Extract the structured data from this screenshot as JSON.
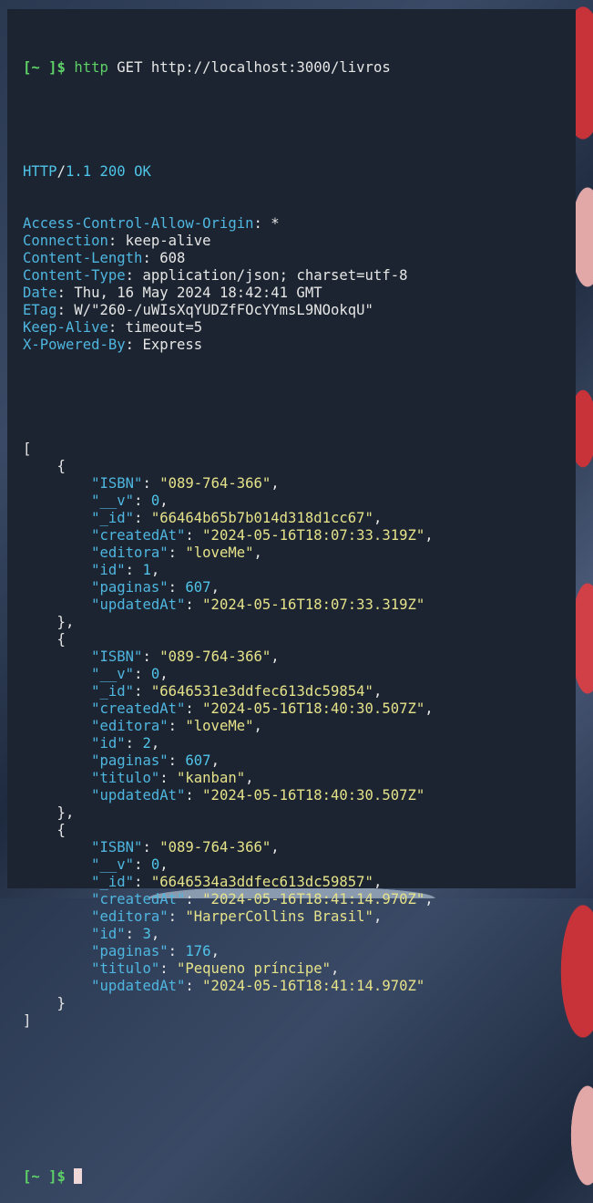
{
  "prompt": "[~ ]$",
  "command": {
    "program": "http",
    "rest": " GET http://localhost:3000/livros"
  },
  "status": {
    "proto": "HTTP",
    "slash": "/",
    "version": "1.1",
    "code": "200",
    "reason": "OK"
  },
  "headers": [
    {
      "name": "Access-Control-Allow-Origin",
      "value": " *"
    },
    {
      "name": "Connection",
      "value": " keep-alive"
    },
    {
      "name": "Content-Length",
      "value": " 608"
    },
    {
      "name": "Content-Type",
      "value": " application/json; charset=utf-8"
    },
    {
      "name": "Date",
      "value": " Thu, 16 May 2024 18:42:41 GMT"
    },
    {
      "name": "ETag",
      "value": " W/\"260-/uWIsXqYUDZfFOcYYmsL9NOokqU\""
    },
    {
      "name": "Keep-Alive",
      "value": " timeout=5"
    },
    {
      "name": "X-Powered-By",
      "value": " Express"
    }
  ],
  "records": [
    [
      {
        "k": "\"ISBN\"",
        "v": "\"089-764-366\"",
        "t": "str"
      },
      {
        "k": "\"__v\"",
        "v": "0",
        "t": "num"
      },
      {
        "k": "\"_id\"",
        "v": "\"66464b65b7b014d318d1cc67\"",
        "t": "str"
      },
      {
        "k": "\"createdAt\"",
        "v": "\"2024-05-16T18:07:33.319Z\"",
        "t": "str"
      },
      {
        "k": "\"editora\"",
        "v": "\"loveMe\"",
        "t": "str"
      },
      {
        "k": "\"id\"",
        "v": "1",
        "t": "num"
      },
      {
        "k": "\"paginas\"",
        "v": "607",
        "t": "num"
      },
      {
        "k": "\"updatedAt\"",
        "v": "\"2024-05-16T18:07:33.319Z\"",
        "t": "str"
      }
    ],
    [
      {
        "k": "\"ISBN\"",
        "v": "\"089-764-366\"",
        "t": "str"
      },
      {
        "k": "\"__v\"",
        "v": "0",
        "t": "num"
      },
      {
        "k": "\"_id\"",
        "v": "\"6646531e3ddfec613dc59854\"",
        "t": "str"
      },
      {
        "k": "\"createdAt\"",
        "v": "\"2024-05-16T18:40:30.507Z\"",
        "t": "str"
      },
      {
        "k": "\"editora\"",
        "v": "\"loveMe\"",
        "t": "str"
      },
      {
        "k": "\"id\"",
        "v": "2",
        "t": "num"
      },
      {
        "k": "\"paginas\"",
        "v": "607",
        "t": "num"
      },
      {
        "k": "\"titulo\"",
        "v": "\"kanban\"",
        "t": "str"
      },
      {
        "k": "\"updatedAt\"",
        "v": "\"2024-05-16T18:40:30.507Z\"",
        "t": "str"
      }
    ],
    [
      {
        "k": "\"ISBN\"",
        "v": "\"089-764-366\"",
        "t": "str"
      },
      {
        "k": "\"__v\"",
        "v": "0",
        "t": "num"
      },
      {
        "k": "\"_id\"",
        "v": "\"6646534a3ddfec613dc59857\"",
        "t": "str"
      },
      {
        "k": "\"createdAt\"",
        "v": "\"2024-05-16T18:41:14.970Z\"",
        "t": "str"
      },
      {
        "k": "\"editora\"",
        "v": "\"HarperCollins Brasil\"",
        "t": "str"
      },
      {
        "k": "\"id\"",
        "v": "3",
        "t": "num"
      },
      {
        "k": "\"paginas\"",
        "v": "176",
        "t": "num"
      },
      {
        "k": "\"titulo\"",
        "v": "\"Pequeno príncipe\"",
        "t": "str"
      },
      {
        "k": "\"updatedAt\"",
        "v": "\"2024-05-16T18:41:14.970Z\"",
        "t": "str"
      }
    ]
  ]
}
